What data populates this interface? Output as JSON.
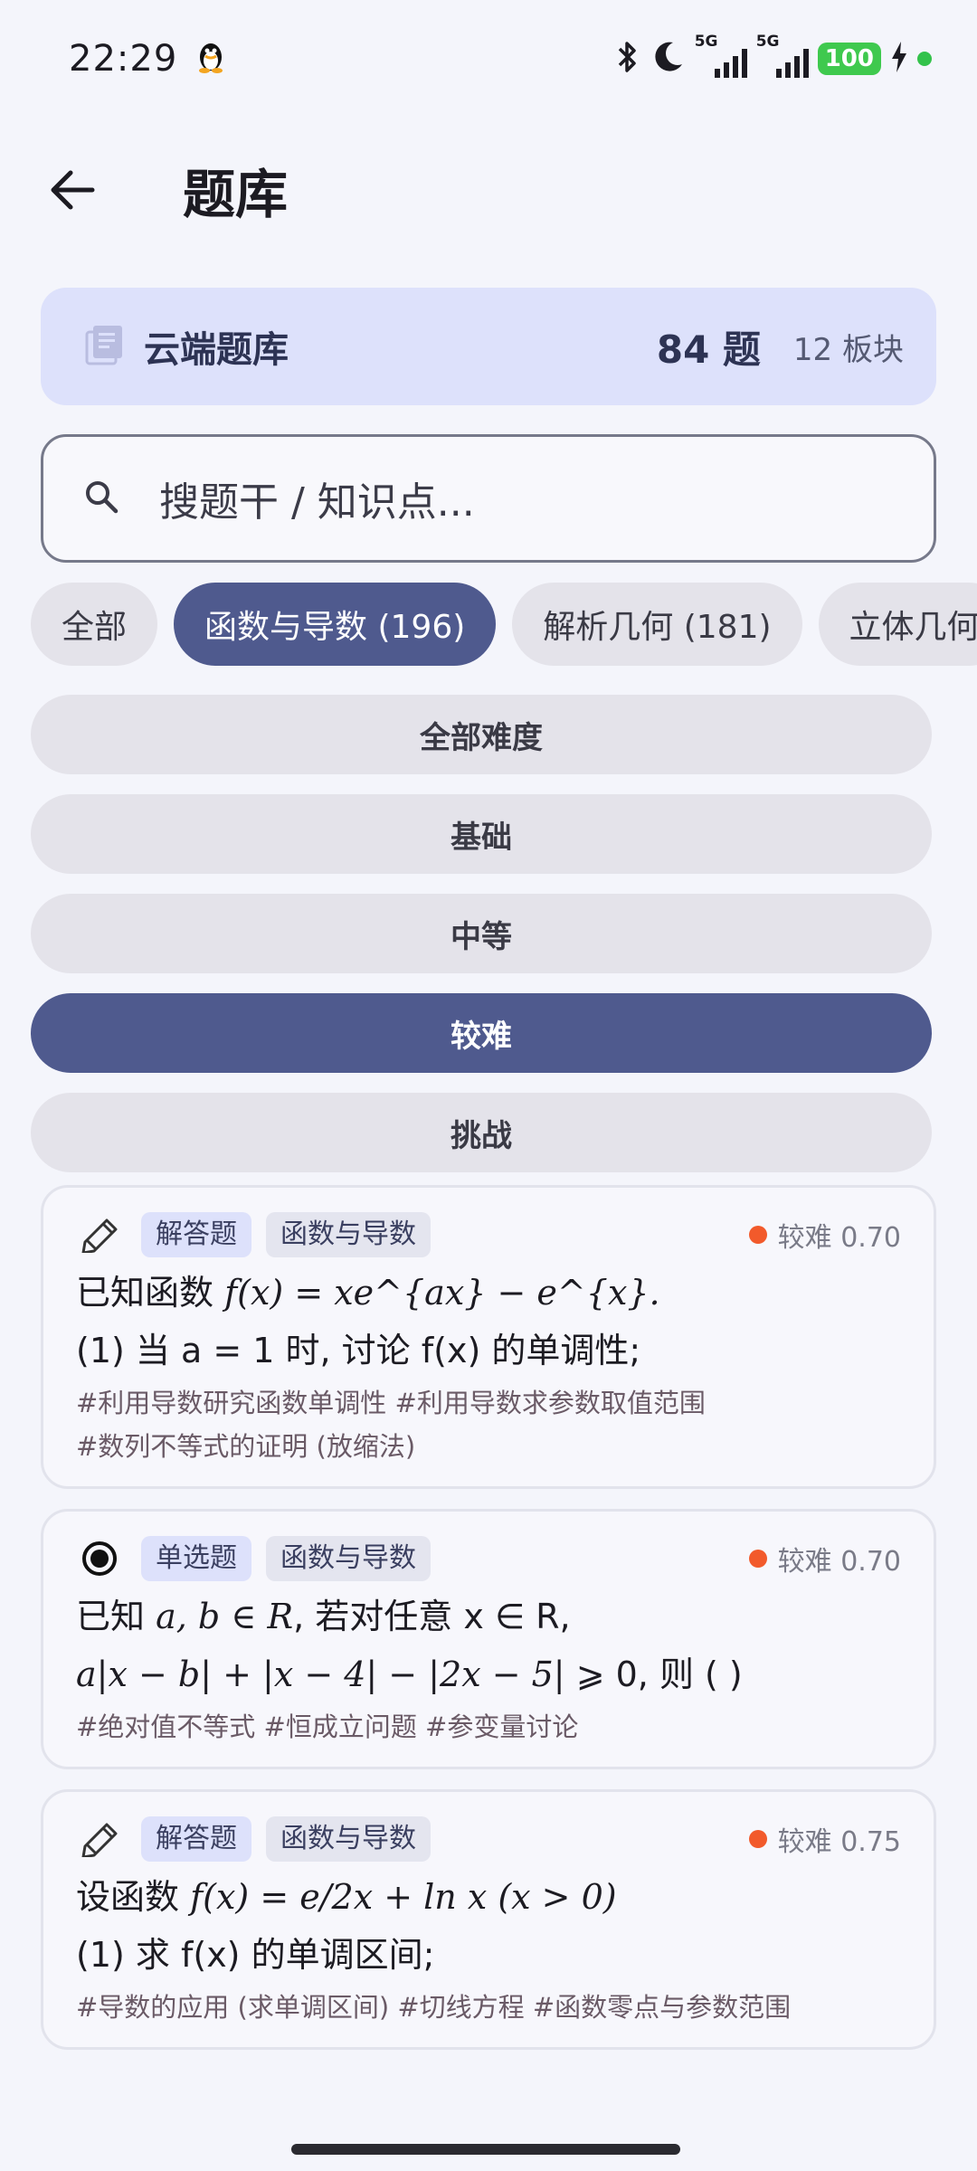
{
  "status_bar": {
    "time": "22:29",
    "net1_label": "5G",
    "net2_label": "5G",
    "battery": "100"
  },
  "app_bar": {
    "title": "题库"
  },
  "summary": {
    "title": "云端题库",
    "count": "84 题",
    "sections": "12 板块"
  },
  "search": {
    "placeholder": "搜题干 / 知识点..."
  },
  "categories": [
    "全部",
    "函数与导数 (196)",
    "解析几何 (181)",
    "立体几何"
  ],
  "active_category": "函数与导数 (196)",
  "difficulties": [
    "全部难度",
    "基础",
    "中等",
    "较难",
    "挑战"
  ],
  "active_difficulty": "较难",
  "colors": {
    "accent": "#4f5a8e",
    "summary_bg": "#dde1fb",
    "difficulty_dot": "#f25a2b",
    "battery": "#3fc94e"
  },
  "questions": [
    {
      "icon": "pencil-icon",
      "type": "解答题",
      "category": "函数与导数",
      "level": "较难 0.70",
      "line1_prefix": "已知函数 ",
      "line1_math": "f(x) = xe^{ax} − e^{x}.",
      "line2": "(1) 当 a = 1 时, 讨论 f(x) 的单调性;",
      "tags1": "#利用导数研究函数单调性 #利用导数求参数取值范围",
      "tags2": "#数列不等式的证明 (放缩法)"
    },
    {
      "icon": "radio-icon",
      "type": "单选题",
      "category": "函数与导数",
      "level": "较难 0.70",
      "line1_prefix": "已知 ",
      "line1_math": "a, b ∈ R",
      "line1_suffix": ", 若对任意 x ∈ R,",
      "line2_math": "a|x − b| + |x − 4| − |2x − 5|",
      "line2_suffix": " ⩾ 0, 则 (  )",
      "tags1": "#绝对值不等式 #恒成立问题 #参变量讨论"
    },
    {
      "icon": "pencil-icon",
      "type": "解答题",
      "category": "函数与导数",
      "level": "较难 0.75",
      "line1_prefix": "设函数 ",
      "line1_math": "f(x) = e/2x + ln x (x > 0)",
      "line2": "(1) 求 f(x) 的单调区间;",
      "tags1": "#导数的应用 (求单调区间) #切线方程 #函数零点与参数范围"
    }
  ]
}
